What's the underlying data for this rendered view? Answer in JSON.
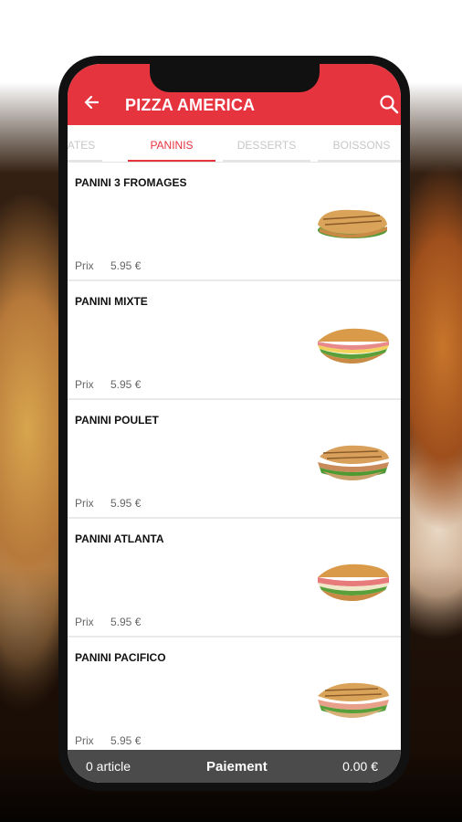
{
  "app": {
    "title": "PIZZA AMERICA"
  },
  "tabs": [
    {
      "label": "ATES"
    },
    {
      "label": "PANINIS",
      "active": true
    },
    {
      "label": "DESSERTS"
    },
    {
      "label": "BOISSONS"
    }
  ],
  "items": [
    {
      "name": "PANINI 3 FROMAGES",
      "price_label": "Prix",
      "price": "5.95 €"
    },
    {
      "name": "PANINI MIXTE",
      "price_label": "Prix",
      "price": "5.95 €"
    },
    {
      "name": "PANINI POULET",
      "price_label": "Prix",
      "price": "5.95 €"
    },
    {
      "name": "PANINI ATLANTA",
      "price_label": "Prix",
      "price": "5.95 €"
    },
    {
      "name": "PANINI PACIFICO",
      "price_label": "Prix",
      "price": "5.95 €"
    }
  ],
  "footer": {
    "count": "0 article",
    "pay_label": "Paiement",
    "total": "0.00 €"
  },
  "colors": {
    "accent": "#e6343f",
    "footer": "#4b4b4b"
  },
  "icons": {
    "back": "arrow-left-icon",
    "search": "search-icon"
  }
}
